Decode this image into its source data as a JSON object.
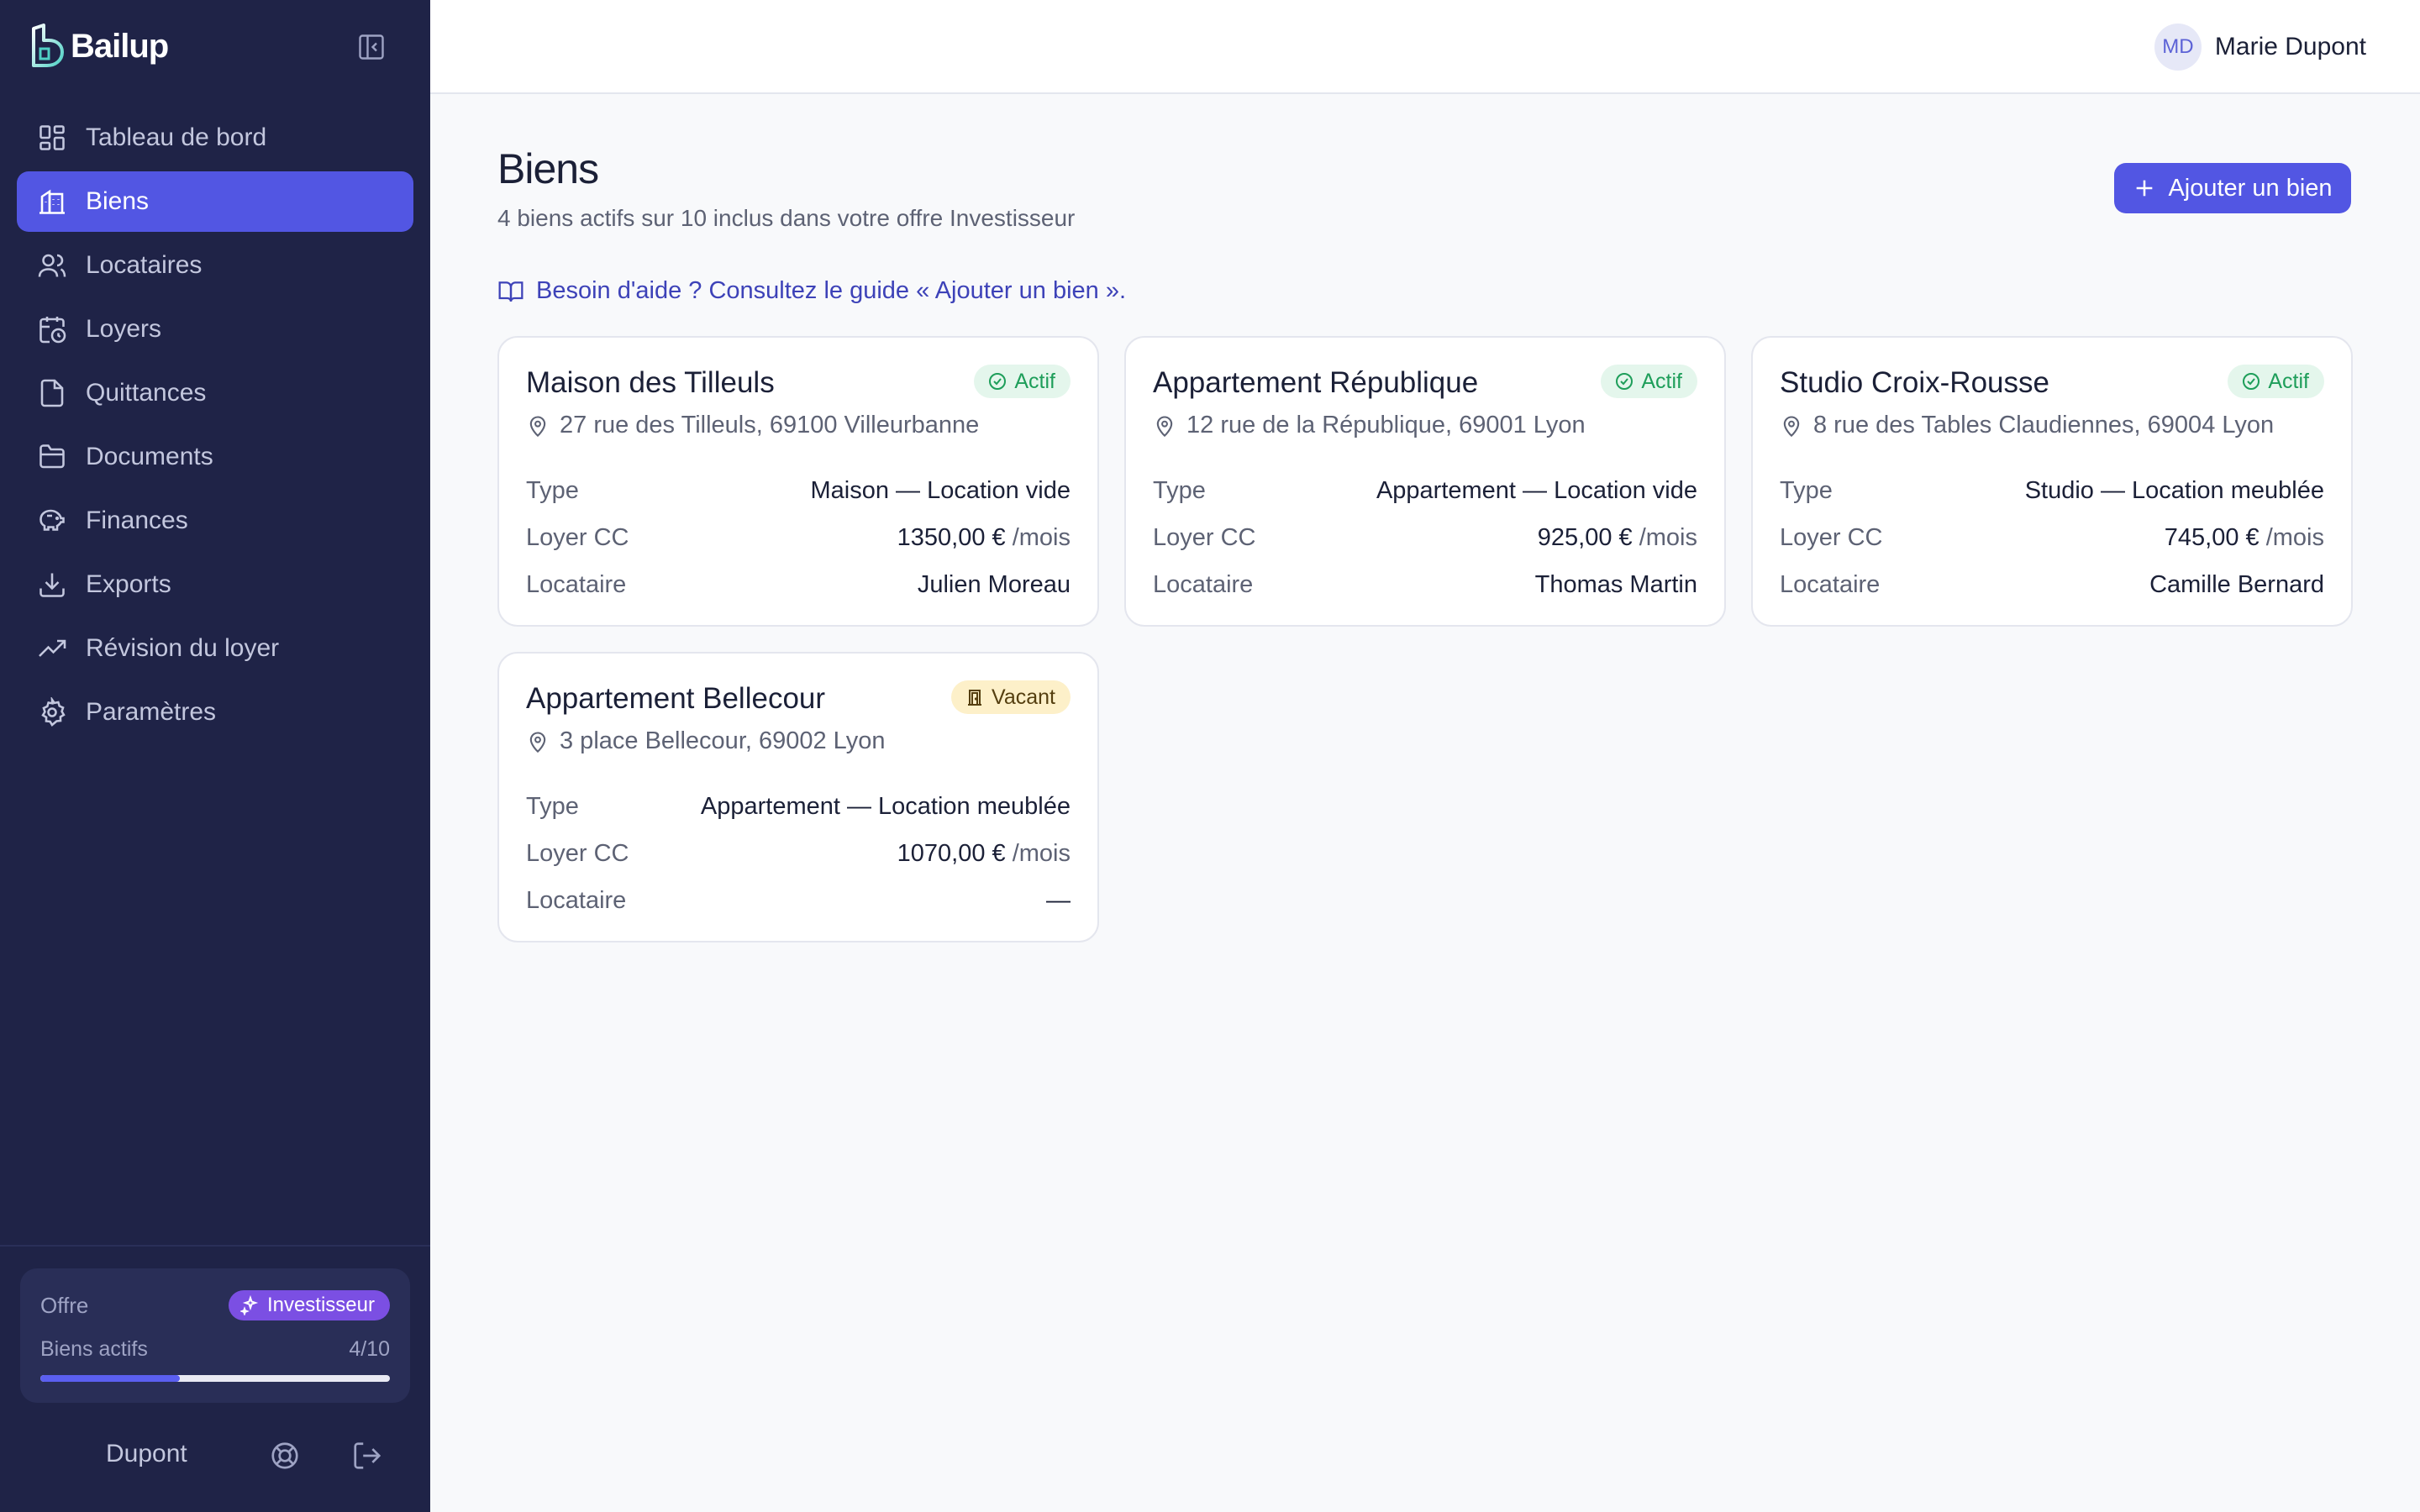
{
  "app": {
    "name": "Bailup"
  },
  "sidebar": {
    "items": [
      {
        "label": "Tableau de bord",
        "icon": "dashboard-icon"
      },
      {
        "label": "Biens",
        "icon": "building-icon",
        "active": true
      },
      {
        "label": "Locataires",
        "icon": "users-icon"
      },
      {
        "label": "Loyers",
        "icon": "calendar-clock-icon"
      },
      {
        "label": "Quittances",
        "icon": "file-icon"
      },
      {
        "label": "Documents",
        "icon": "folder-icon"
      },
      {
        "label": "Finances",
        "icon": "piggy-bank-icon"
      },
      {
        "label": "Exports",
        "icon": "download-icon"
      },
      {
        "label": "Révision du loyer",
        "icon": "trending-up-icon"
      },
      {
        "label": "Paramètres",
        "icon": "settings-icon"
      }
    ],
    "plan": {
      "label": "Offre",
      "badge": "Investisseur",
      "count_label": "Biens actifs",
      "count": "4/10",
      "progress": 0.4
    },
    "footer": {
      "name": "Dupont"
    }
  },
  "header": {
    "user": {
      "initials": "MD",
      "name": "Marie Dupont"
    }
  },
  "main": {
    "title": "Biens",
    "subtitle": "4 biens actifs sur 10 inclus dans votre offre Investisseur",
    "add_button": "Ajouter un bien",
    "help_link": "Besoin d'aide ? Consultez le guide « Ajouter un bien ».",
    "row_labels": {
      "type": "Type",
      "rent": "Loyer CC",
      "tenant": "Locataire"
    },
    "properties": [
      {
        "name": "Maison des Tilleuls",
        "status": "Actif",
        "address": "27 rue des Tilleuls, 69100 Villeurbanne",
        "type": "Maison — Location vide",
        "rent": "1350,00 €",
        "rent_unit": "/mois",
        "tenant": "Julien Moreau"
      },
      {
        "name": "Appartement République",
        "status": "Actif",
        "address": "12 rue de la République, 69001 Lyon",
        "type": "Appartement — Location vide",
        "rent": "925,00 €",
        "rent_unit": "/mois",
        "tenant": "Thomas Martin"
      },
      {
        "name": "Studio Croix-Rousse",
        "status": "Actif",
        "address": "8 rue des Tables Claudiennes, 69004 Lyon",
        "type": "Studio — Location meublée",
        "rent": "745,00 €",
        "rent_unit": "/mois",
        "tenant": "Camille Bernard"
      },
      {
        "name": "Appartement Bellecour",
        "status": "Vacant",
        "address": "3 place Bellecour, 69002 Lyon",
        "type": "Appartement — Location meublée",
        "rent": "1070,00 €",
        "rent_unit": "/mois",
        "tenant": "—"
      }
    ]
  },
  "colors": {
    "sidebar_bg": "#1f2347",
    "accent": "#5256e3",
    "active_badge": "#1e9e5a",
    "vacant_badge": "#fdf0c9",
    "plan_badge": "#7b4fe3"
  }
}
